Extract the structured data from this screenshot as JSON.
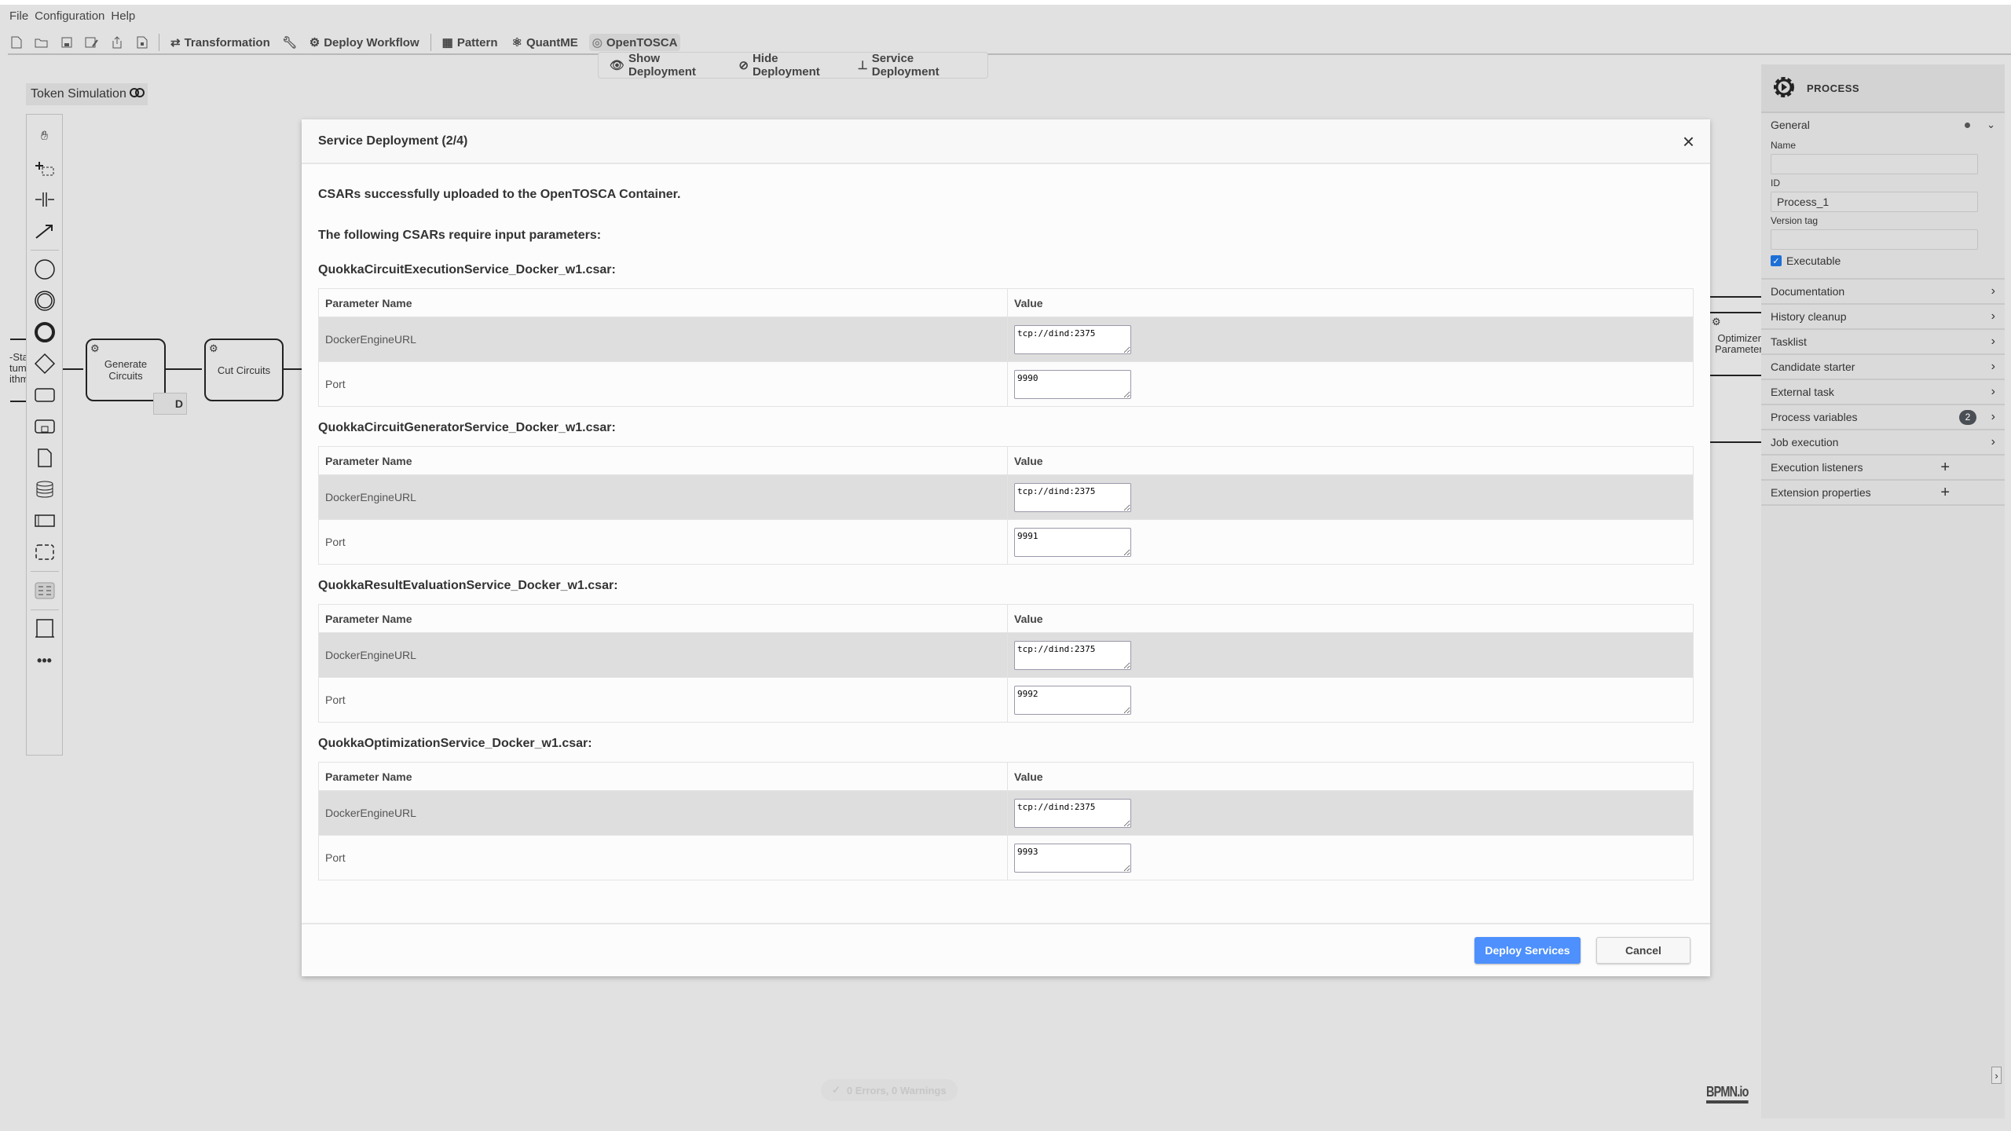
{
  "menu": [
    "File",
    "Configuration",
    "Help"
  ],
  "toolbar": {
    "transformation": "Transformation",
    "deploy_workflow": "Deploy Workflow",
    "pattern": "Pattern",
    "quantme": "QuantME",
    "opentosca": "OpenTOSCA"
  },
  "opentosca_menu": {
    "show": "Show Deployment",
    "hide": "Hide Deployment",
    "service": "Service Deployment"
  },
  "token_simulation": "Token Simulation",
  "canvas": {
    "tasks": [
      "Generate Circuits",
      "Cut Circuits"
    ],
    "left_fragment": [
      "-Sta",
      "tum",
      "ithm"
    ],
    "right_fragment": [
      "Optimizer",
      "Parameter"
    ],
    "deployment_marker": "D"
  },
  "modal": {
    "title": "Service Deployment (2/4)",
    "message1": "CSARs successfully uploaded to the OpenTOSCA Container.",
    "message2": "The following CSARs require input parameters:",
    "col_name": "Parameter Name",
    "col_value": "Value",
    "csars": [
      {
        "name": "QuokkaCircuitExecutionService_Docker_w1.csar:",
        "params": [
          {
            "name": "DockerEngineURL",
            "value": "tcp://dind:2375"
          },
          {
            "name": "Port",
            "value": "9990"
          }
        ]
      },
      {
        "name": "QuokkaCircuitGeneratorService_Docker_w1.csar:",
        "params": [
          {
            "name": "DockerEngineURL",
            "value": "tcp://dind:2375"
          },
          {
            "name": "Port",
            "value": "9991"
          }
        ]
      },
      {
        "name": "QuokkaResultEvaluationService_Docker_w1.csar:",
        "params": [
          {
            "name": "DockerEngineURL",
            "value": "tcp://dind:2375"
          },
          {
            "name": "Port",
            "value": "9992"
          }
        ]
      },
      {
        "name": "QuokkaOptimizationService_Docker_w1.csar:",
        "params": [
          {
            "name": "DockerEngineURL",
            "value": "tcp://dind:2375"
          },
          {
            "name": "Port",
            "value": "9993"
          }
        ]
      }
    ],
    "deploy_label": "Deploy Services",
    "cancel_label": "Cancel",
    "primary_color": "#4d90fe"
  },
  "panel": {
    "title": "PROCESS",
    "general": "General",
    "name_label": "Name",
    "name_value": "",
    "id_label": "ID",
    "id_value": "Process_1",
    "version_label": "Version tag",
    "version_value": "",
    "executable_label": "Executable",
    "executable": true,
    "groups": [
      {
        "label": "Documentation",
        "action": "chevron"
      },
      {
        "label": "History cleanup",
        "action": "chevron"
      },
      {
        "label": "Tasklist",
        "action": "chevron"
      },
      {
        "label": "Candidate starter",
        "action": "chevron"
      },
      {
        "label": "External task",
        "action": "chevron"
      },
      {
        "label": "Process variables",
        "action": "chevron",
        "badge": "2"
      },
      {
        "label": "Job execution",
        "action": "chevron"
      },
      {
        "label": "Execution listeners",
        "action": "plus"
      },
      {
        "label": "Extension properties",
        "action": "plus"
      }
    ]
  },
  "status": "0 Errors, 0 Warnings",
  "logo": "BPMN.io"
}
